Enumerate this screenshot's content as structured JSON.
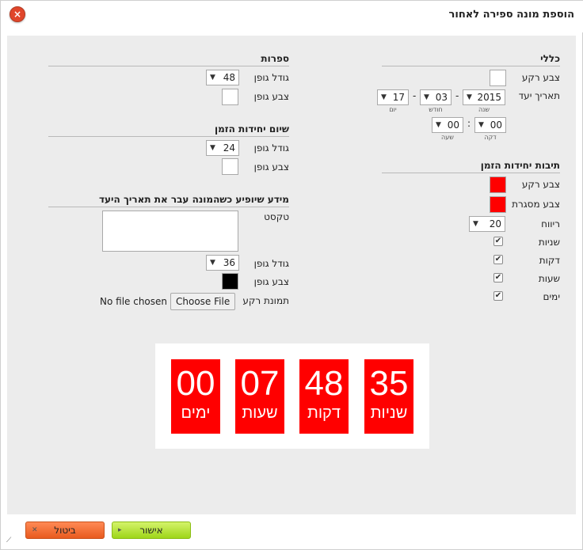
{
  "dialog": {
    "title": "הוספת מונה ספירה לאחור",
    "close_icon": "×"
  },
  "general": {
    "heading": "כללי",
    "bg_color_label": "צבע רקע",
    "bg_color": "#ffffff",
    "target_date_label": "תאריך יעד",
    "year": "2015",
    "month": "03",
    "day": "17",
    "year_caption": "שנה",
    "month_caption": "חודש",
    "day_caption": "יום",
    "hour": "00",
    "minute": "00",
    "hour_caption": "שעה",
    "minute_caption": "דקה",
    "date_sep": "-",
    "time_sep": ":"
  },
  "boxes": {
    "heading": "תיבות יחידות הזמן",
    "bg_color_label": "צבע רקע",
    "bg_color": "#ff0000",
    "border_color_label": "צבע מסגרת",
    "border_color": "#ff0000",
    "spacing_label": "ריווח",
    "spacing": "20",
    "years_label": "שניות",
    "minutes_label": "דקות",
    "hours_label": "שעות",
    "days_label": "ימים",
    "check_mark": "✔"
  },
  "digits": {
    "heading": "ספרות",
    "font_size_label": "גודל גופן",
    "font_size": "48",
    "font_color_label": "צבע גופן",
    "font_color": "#ffffff"
  },
  "unit_names": {
    "heading": "שיום יחידות הזמן",
    "font_size_label": "גודל גופן",
    "font_size": "24",
    "font_color_label": "צבע גופן",
    "font_color": "#ffffff"
  },
  "expired": {
    "heading": "מידע שיופיע כשהמונה עבר את תאריך היעד",
    "text_label": "טקסט",
    "text_value": "",
    "font_size_label": "גודל גופן",
    "font_size": "36",
    "font_color_label": "צבע גופן",
    "font_color": "#000000",
    "bg_image_label": "תמונת רקע",
    "choose_file": "Choose File",
    "no_file": "No file chosen"
  },
  "preview": {
    "tiles": [
      {
        "num": "00",
        "unit": "ימים"
      },
      {
        "num": "07",
        "unit": "שעות"
      },
      {
        "num": "48",
        "unit": "דקות"
      },
      {
        "num": "35",
        "unit": "שניות"
      }
    ],
    "tile_color": "#ff0000"
  },
  "footer": {
    "cancel_label": "ביטול",
    "ok_label": "אישור",
    "cancel_icon": "✕",
    "ok_icon": "▸"
  },
  "dropdown_arrow": "▼"
}
